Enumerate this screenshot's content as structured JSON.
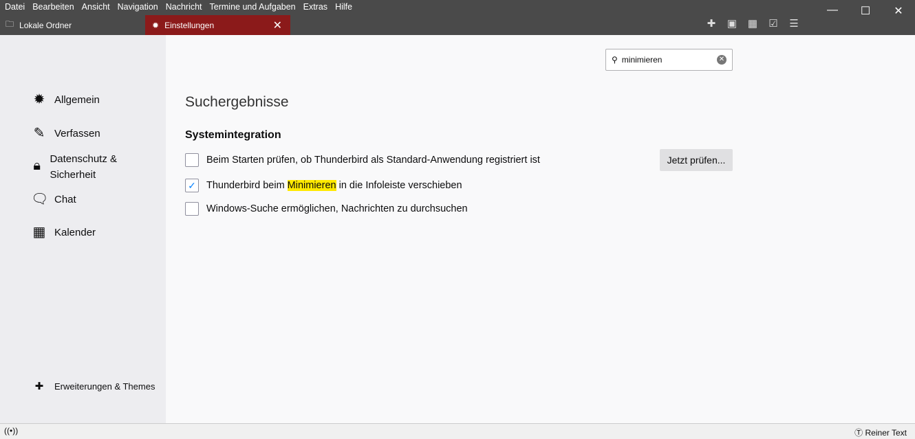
{
  "menu": [
    "Datei",
    "Bearbeiten",
    "Ansicht",
    "Navigation",
    "Nachricht",
    "Termine und Aufgaben",
    "Extras",
    "Hilfe"
  ],
  "tabs": {
    "folder": "Lokale Ordner",
    "settings": "Einstellungen"
  },
  "sidebar": {
    "items": [
      "Allgemein",
      "Verfassen",
      "Datenschutz & Sicherheit",
      "Chat",
      "Kalender"
    ],
    "addons": "Erweiterungen & Themes"
  },
  "search": {
    "value": "minimieren"
  },
  "main": {
    "title": "Suchergebnisse",
    "section": "Systemintegration",
    "opt1": "Beim Starten prüfen, ob Thunderbird als Standard-Anwendung registriert ist",
    "opt2_pre": "Thunderbird beim ",
    "opt2_hl": "Minimieren",
    "opt2_post": " in die Infoleiste verschieben",
    "opt3": "Windows-Suche ermöglichen, Nachrichten zu durchsuchen",
    "check_now": "Jetzt prüfen..."
  },
  "status": {
    "format": "Reiner Text"
  }
}
